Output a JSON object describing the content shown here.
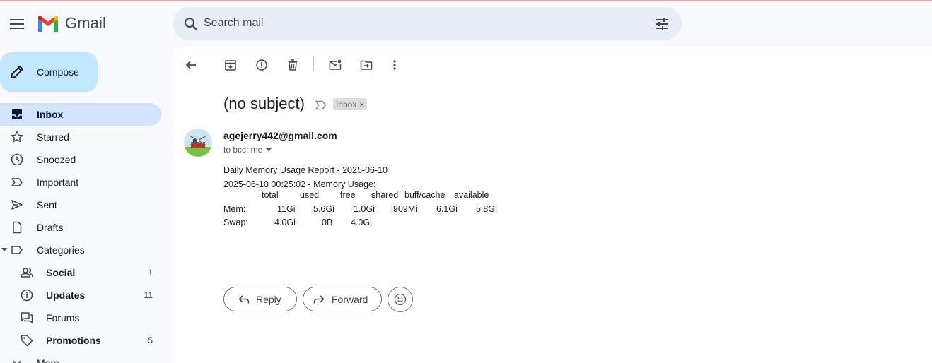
{
  "app": {
    "name": "Gmail"
  },
  "search": {
    "placeholder": "Search mail"
  },
  "compose": {
    "label": "Compose"
  },
  "sidebar": {
    "items": [
      {
        "label": "Inbox",
        "icon": "inbox-icon",
        "active": true
      },
      {
        "label": "Starred",
        "icon": "star-icon"
      },
      {
        "label": "Snoozed",
        "icon": "clock-icon"
      },
      {
        "label": "Important",
        "icon": "important-icon"
      },
      {
        "label": "Sent",
        "icon": "send-icon"
      },
      {
        "label": "Drafts",
        "icon": "draft-icon"
      },
      {
        "label": "Categories",
        "icon": "label-icon"
      }
    ],
    "categories": [
      {
        "label": "Social",
        "count": "1",
        "icon": "people-icon"
      },
      {
        "label": "Updates",
        "count": "11",
        "icon": "info-icon"
      },
      {
        "label": "Forums",
        "count": "",
        "icon": "forum-icon"
      },
      {
        "label": "Promotions",
        "count": "5",
        "icon": "tag-icon"
      }
    ],
    "more_label": "More"
  },
  "email": {
    "subject": "(no subject)",
    "label": "Inbox",
    "sender": "agejerry442@gmail.com",
    "recipients": "to bcc: me",
    "body_lines": [
      "Daily Memory Usage Report - 2025-06-10",
      "2025-06-10 00:25:02 - Memory Usage:"
    ],
    "table": {
      "headers": [
        "total",
        "used",
        "free",
        "shared",
        "buff/cache",
        "available"
      ],
      "rows": [
        {
          "label": "Mem:",
          "values": [
            "11Gi",
            "5.6Gi",
            "1.0Gi",
            "909Mi",
            "6.1Gi",
            "5.8Gi"
          ]
        },
        {
          "label": "Swap:",
          "values": [
            "4.0Gi",
            "0B",
            "4.0Gi",
            "",
            "",
            ""
          ]
        }
      ]
    }
  },
  "actions": {
    "reply": "Reply",
    "forward": "Forward"
  },
  "colors": {
    "accent": "#c2e7ff",
    "active_nav": "#d3e3fd",
    "search_bg": "#e9eef6"
  }
}
